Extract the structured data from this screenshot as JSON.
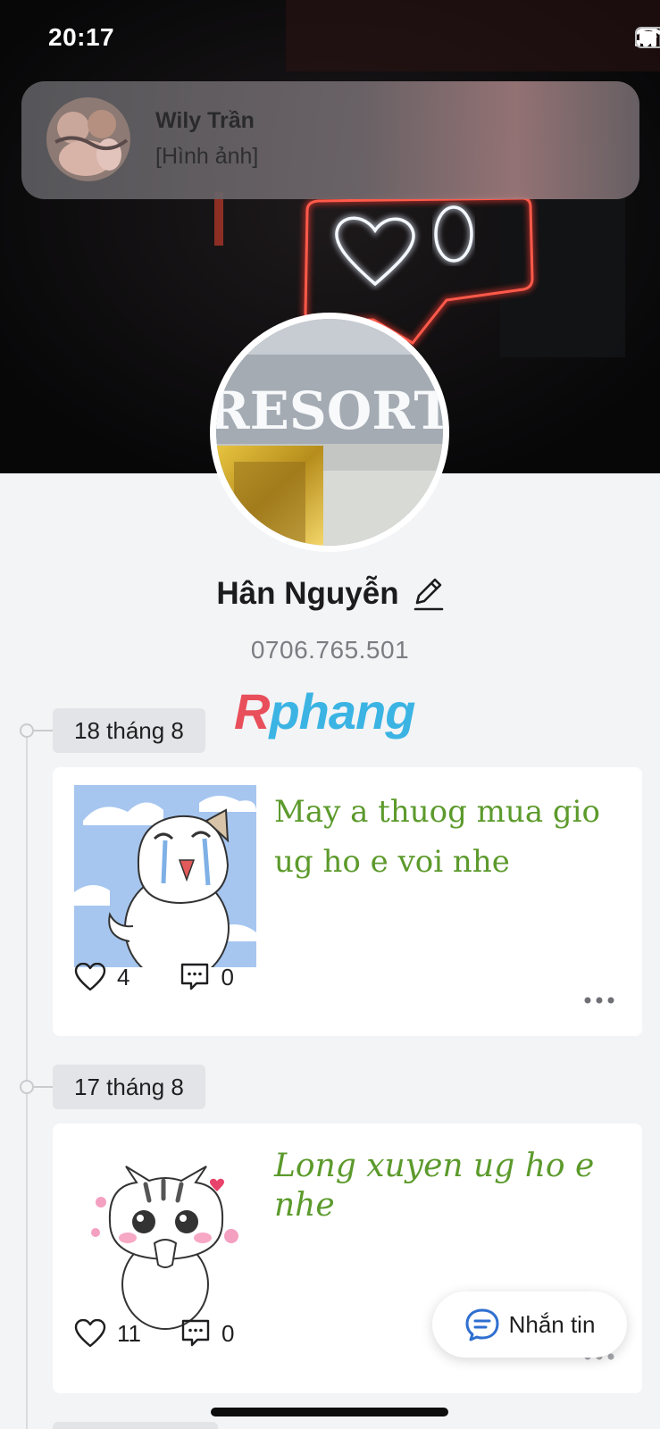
{
  "status_bar": {
    "time": "20:17",
    "icons": [
      "cellular-signal-icon",
      "wifi-icon",
      "battery-icon"
    ]
  },
  "notification": {
    "sender": "Wily Trần",
    "message": "[Hình ảnh]"
  },
  "cover": {
    "neon_colors": {
      "frame": "#ff3b30",
      "heart": "#dfeaff"
    }
  },
  "profile": {
    "avatar_sign_text": "RESORT",
    "name": "Hân Nguyễn",
    "phone": "0706.765.501",
    "edit_icon": "pencil-icon"
  },
  "watermark": {
    "part1": "R",
    "part2": "phang"
  },
  "timeline": [
    {
      "date": "18 tháng 8",
      "text": "May a thuog mua gio ug ho e voi nhe",
      "likes": "4",
      "comments": "0",
      "image": "crying-cat-sticker"
    },
    {
      "date": "17 tháng 8",
      "text": "Long xuyen ug ho e nhe",
      "likes": "11",
      "comments": "0",
      "image": "pleading-cat-sticker"
    }
  ],
  "message_button": {
    "label": "Nhắn tin",
    "icon": "chat-bubble-icon"
  },
  "colors": {
    "accent_blue": "#2f6fd0",
    "post_text_green": "#5c9a2c",
    "page_background": "#f3f4f6"
  }
}
